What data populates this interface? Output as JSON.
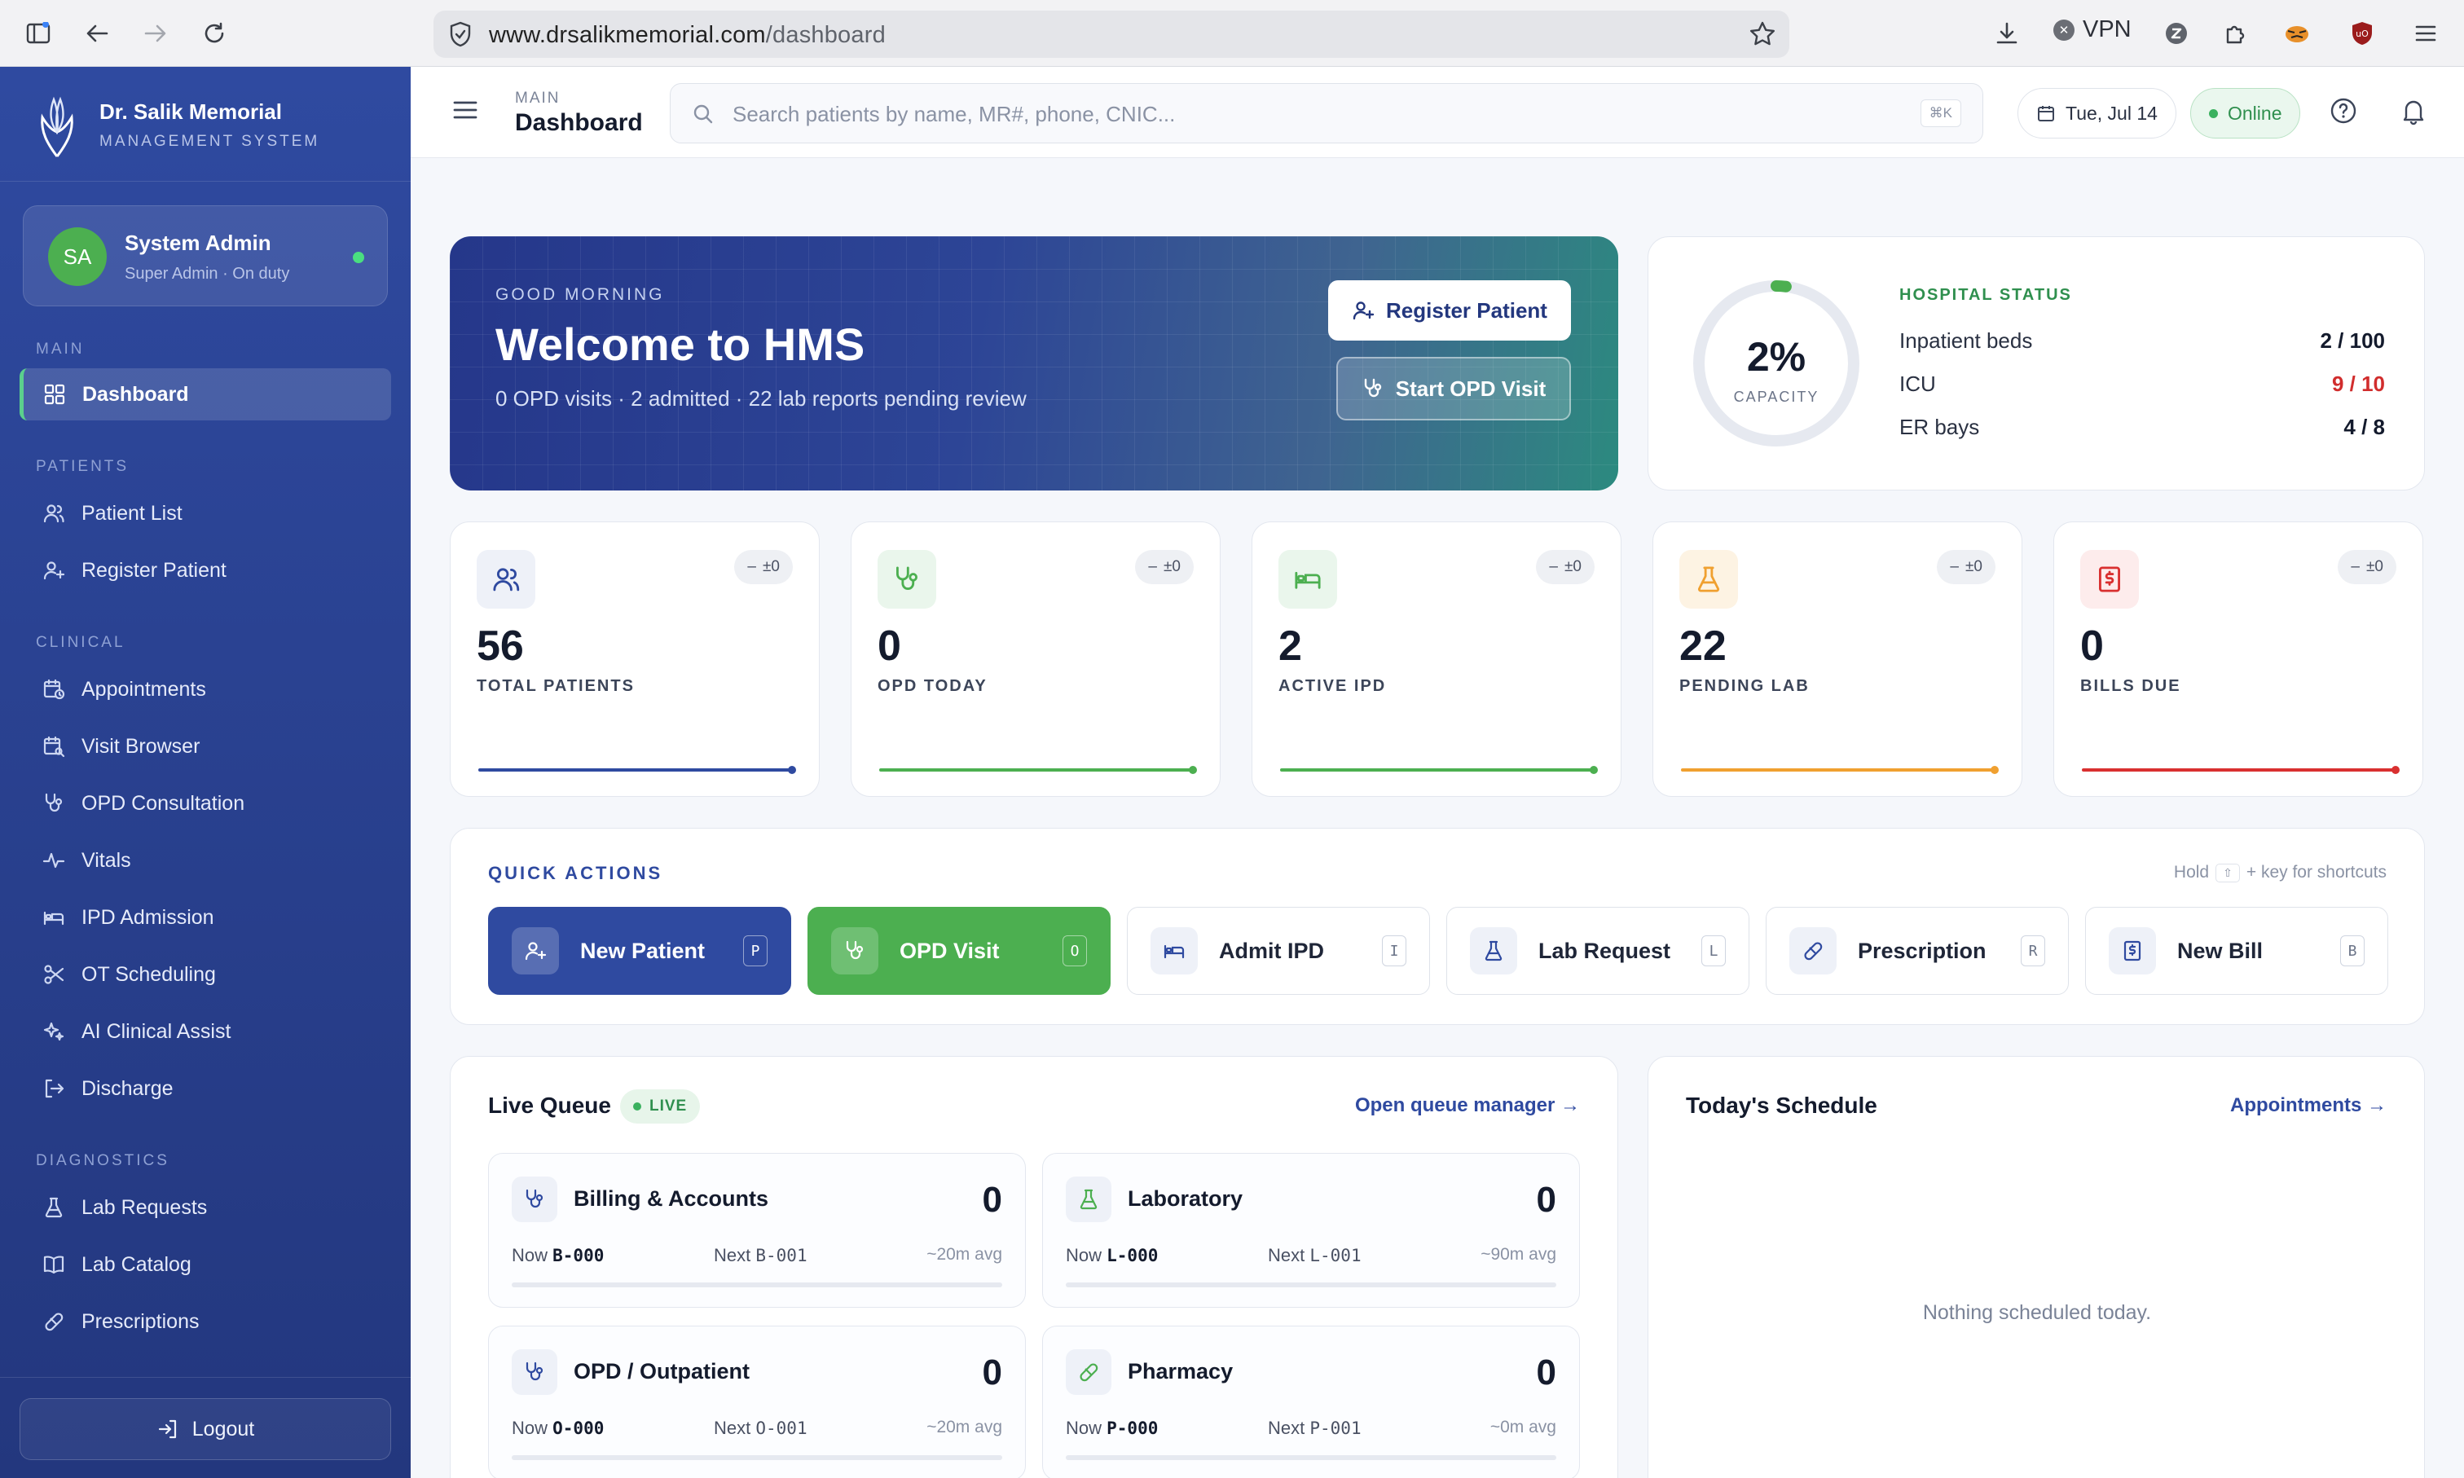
{
  "browser": {
    "url_host": "www.drsalikmemorial.com",
    "url_path": "/dashboard",
    "vpn_label": "VPN"
  },
  "sidebar": {
    "brand_name": "Dr. Salik Memorial",
    "brand_sub": "MANAGEMENT SYSTEM",
    "user": {
      "initials": "SA",
      "name": "System Admin",
      "role": "Super Admin · On duty"
    },
    "sections": {
      "main": "MAIN",
      "patients": "PATIENTS",
      "clinical": "CLINICAL",
      "diagnostics": "DIAGNOSTICS"
    },
    "items": [
      {
        "label": "Dashboard",
        "icon": "grid-icon"
      },
      {
        "label": "Patient List",
        "icon": "users-icon"
      },
      {
        "label": "Register Patient",
        "icon": "user-plus-icon"
      },
      {
        "label": "Appointments",
        "icon": "calendar-clock-icon"
      },
      {
        "label": "Visit Browser",
        "icon": "calendar-search-icon"
      },
      {
        "label": "OPD Consultation",
        "icon": "stethoscope-icon"
      },
      {
        "label": "Vitals",
        "icon": "pulse-icon"
      },
      {
        "label": "IPD Admission",
        "icon": "bed-icon"
      },
      {
        "label": "OT Scheduling",
        "icon": "scissors-icon"
      },
      {
        "label": "AI Clinical Assist",
        "icon": "sparkles-icon"
      },
      {
        "label": "Discharge",
        "icon": "logout-arrow-icon"
      },
      {
        "label": "Lab Requests",
        "icon": "flask-icon"
      },
      {
        "label": "Lab Catalog",
        "icon": "book-icon"
      },
      {
        "label": "Prescriptions",
        "icon": "pill-icon"
      }
    ],
    "logout_label": "Logout"
  },
  "topbar": {
    "crumb_section": "MAIN",
    "crumb_page": "Dashboard",
    "search_placeholder": "Search patients by name, MR#, phone, CNIC...",
    "search_shortcut": "⌘K",
    "date": "Tue, Jul 14",
    "status": "Online"
  },
  "hero": {
    "greeting": "GOOD MORNING",
    "title": "Welcome to HMS",
    "summary": "0 OPD visits · 2 admitted · 22 lab reports pending review",
    "register_button": "Register Patient",
    "opd_button": "Start OPD Visit"
  },
  "hospital_status": {
    "title": "HOSPITAL STATUS",
    "capacity_value": "2%",
    "capacity_fraction": 0.02,
    "capacity_label": "CAPACITY",
    "rows": [
      {
        "label": "Inpatient beds",
        "value": "2 / 100"
      },
      {
        "label": "ICU",
        "value": "9 / 10"
      },
      {
        "label": "ER bays",
        "value": "4 / 8"
      }
    ]
  },
  "stats": [
    {
      "value": "56",
      "label": "TOTAL PATIENTS",
      "delta": "±0",
      "color": "#2f4aa0",
      "tint": "#eef1f8"
    },
    {
      "value": "0",
      "label": "OPD TODAY",
      "delta": "±0",
      "color": "#4caf50",
      "tint": "#eaf6ec"
    },
    {
      "value": "2",
      "label": "ACTIVE IPD",
      "delta": "±0",
      "color": "#4caf50",
      "tint": "#eaf6ec"
    },
    {
      "value": "22",
      "label": "PENDING LAB",
      "delta": "±0",
      "color": "#f0a030",
      "tint": "#fdf3e3"
    },
    {
      "value": "0",
      "label": "BILLS DUE",
      "delta": "±0",
      "color": "#d93030",
      "tint": "#fdecec"
    }
  ],
  "quick_actions": {
    "title": "QUICK ACTIONS",
    "hint_prefix": "Hold",
    "hint_key": "⇧",
    "hint_suffix": "+ key for shortcuts",
    "items": [
      {
        "label": "New Patient",
        "key": "P"
      },
      {
        "label": "OPD Visit",
        "key": "O"
      },
      {
        "label": "Admit IPD",
        "key": "I"
      },
      {
        "label": "Lab Request",
        "key": "L"
      },
      {
        "label": "Prescription",
        "key": "R"
      },
      {
        "label": "New Bill",
        "key": "B"
      }
    ]
  },
  "live_queue": {
    "title": "Live Queue",
    "badge": "LIVE",
    "link": "Open queue manager →",
    "now_label": "Now",
    "next_label": "Next",
    "queues": [
      {
        "name": "Billing & Accounts",
        "count": "0",
        "now": "B-000",
        "next": "B-001",
        "avg": "~20m avg",
        "progress": 0
      },
      {
        "name": "Laboratory",
        "count": "0",
        "now": "L-000",
        "next": "L-001",
        "avg": "~90m avg",
        "progress": 0
      },
      {
        "name": "OPD / Outpatient",
        "count": "0",
        "now": "O-000",
        "next": "O-001",
        "avg": "~20m avg",
        "progress": 0
      },
      {
        "name": "Pharmacy",
        "count": "0",
        "now": "P-000",
        "next": "P-001",
        "avg": "~0m avg",
        "progress": 0
      }
    ]
  },
  "schedule": {
    "title": "Today's Schedule",
    "link": "Appointments →",
    "empty": "Nothing scheduled today."
  }
}
